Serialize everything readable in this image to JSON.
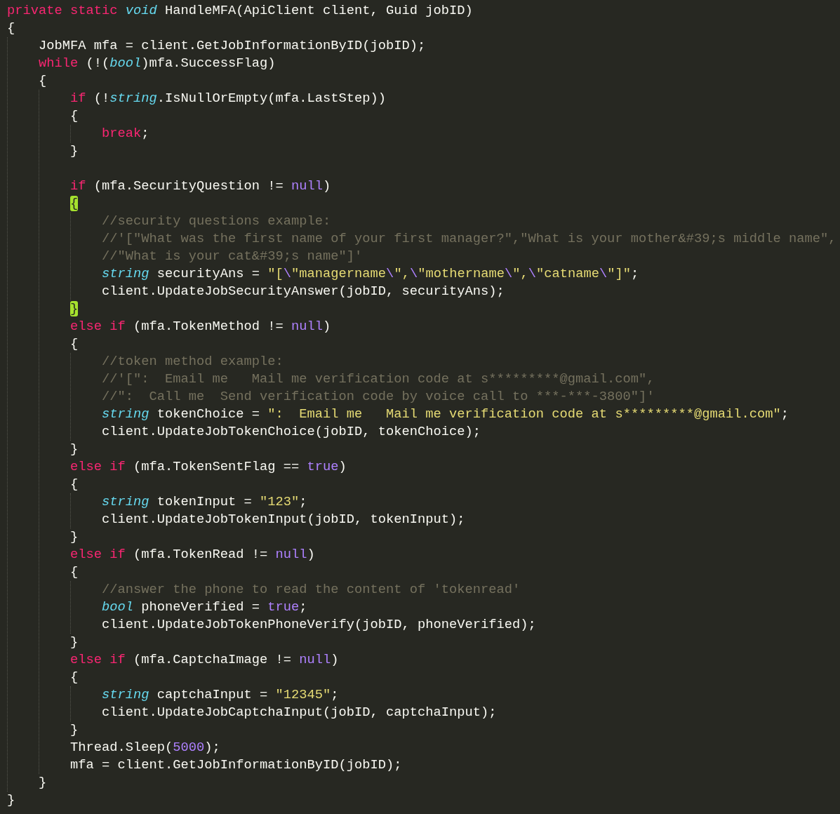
{
  "editor": {
    "lines": [
      {
        "kind": "code",
        "tokens": [
          {
            "kind": "keyword",
            "text": "private static "
          },
          {
            "kind": "type",
            "text": "void"
          },
          {
            "kind": "plain",
            "text": " HandleMFA(ApiClient client, Guid jobID)"
          }
        ]
      },
      {
        "kind": "code",
        "tokens": [
          {
            "kind": "plain",
            "text": "{"
          }
        ],
        "children": [
          {
            "kind": "code",
            "tokens": [
              {
                "kind": "plain",
                "text": "JobMFA mfa = client.GetJobInformationByID(jobID);"
              }
            ]
          },
          {
            "kind": "code",
            "tokens": [
              {
                "kind": "keyword",
                "text": "while"
              },
              {
                "kind": "plain",
                "text": " (!("
              },
              {
                "kind": "type",
                "text": "bool"
              },
              {
                "kind": "plain",
                "text": ")mfa.SuccessFlag)"
              }
            ]
          },
          {
            "kind": "code",
            "tokens": [
              {
                "kind": "plain",
                "text": "{"
              }
            ],
            "children": [
              {
                "kind": "code",
                "tokens": [
                  {
                    "kind": "keyword",
                    "text": "if"
                  },
                  {
                    "kind": "plain",
                    "text": " (!"
                  },
                  {
                    "kind": "type",
                    "text": "string"
                  },
                  {
                    "kind": "plain",
                    "text": ".IsNullOrEmpty(mfa.LastStep))"
                  }
                ]
              },
              {
                "kind": "code",
                "tokens": [
                  {
                    "kind": "plain",
                    "text": "{"
                  }
                ],
                "children": [
                  {
                    "kind": "code",
                    "tokens": [
                      {
                        "kind": "keyword",
                        "text": "break"
                      },
                      {
                        "kind": "plain",
                        "text": ";"
                      }
                    ]
                  }
                ]
              },
              {
                "kind": "code",
                "tokens": [
                  {
                    "kind": "plain",
                    "text": "}"
                  }
                ]
              },
              {
                "kind": "blank"
              },
              {
                "kind": "code",
                "tokens": [
                  {
                    "kind": "keyword",
                    "text": "if"
                  },
                  {
                    "kind": "plain",
                    "text": " (mfa.SecurityQuestion != "
                  },
                  {
                    "kind": "constant",
                    "text": "null"
                  },
                  {
                    "kind": "plain",
                    "text": ")"
                  }
                ]
              },
              {
                "kind": "code",
                "tokens": [
                  {
                    "kind": "match",
                    "text": "{"
                  }
                ],
                "children": [
                  {
                    "kind": "code",
                    "tokens": [
                      {
                        "kind": "comment",
                        "text": "//security questions example:"
                      }
                    ]
                  },
                  {
                    "kind": "code",
                    "tokens": [
                      {
                        "kind": "comment",
                        "text": "//'[\"What was the first name of your first manager?\",\"What is your mother&#39;s middle name\","
                      }
                    ]
                  },
                  {
                    "kind": "code",
                    "tokens": [
                      {
                        "kind": "comment",
                        "text": "//\"What is your cat&#39;s name\"]'"
                      }
                    ]
                  },
                  {
                    "kind": "code",
                    "tokens": [
                      {
                        "kind": "type",
                        "text": "string"
                      },
                      {
                        "kind": "plain",
                        "text": " securityAns = "
                      },
                      {
                        "kind": "string",
                        "text": "\"["
                      },
                      {
                        "kind": "escape",
                        "text": "\\"
                      },
                      {
                        "kind": "string",
                        "text": "\"managername"
                      },
                      {
                        "kind": "escape",
                        "text": "\\"
                      },
                      {
                        "kind": "string",
                        "text": "\","
                      },
                      {
                        "kind": "escape",
                        "text": "\\"
                      },
                      {
                        "kind": "string",
                        "text": "\"mothername"
                      },
                      {
                        "kind": "escape",
                        "text": "\\"
                      },
                      {
                        "kind": "string",
                        "text": "\","
                      },
                      {
                        "kind": "escape",
                        "text": "\\"
                      },
                      {
                        "kind": "string",
                        "text": "\"catname"
                      },
                      {
                        "kind": "escape",
                        "text": "\\"
                      },
                      {
                        "kind": "string",
                        "text": "\"]\""
                      },
                      {
                        "kind": "plain",
                        "text": ";"
                      }
                    ]
                  },
                  {
                    "kind": "code",
                    "tokens": [
                      {
                        "kind": "plain",
                        "text": "client.UpdateJobSecurityAnswer(jobID, securityAns);"
                      }
                    ]
                  }
                ]
              },
              {
                "kind": "code",
                "tokens": [
                  {
                    "kind": "match",
                    "text": "}"
                  }
                ]
              },
              {
                "kind": "code",
                "tokens": [
                  {
                    "kind": "keyword",
                    "text": "else if"
                  },
                  {
                    "kind": "plain",
                    "text": " (mfa.TokenMethod != "
                  },
                  {
                    "kind": "constant",
                    "text": "null"
                  },
                  {
                    "kind": "plain",
                    "text": ")"
                  }
                ]
              },
              {
                "kind": "code",
                "tokens": [
                  {
                    "kind": "plain",
                    "text": "{"
                  }
                ],
                "children": [
                  {
                    "kind": "code",
                    "tokens": [
                      {
                        "kind": "comment",
                        "text": "//token method example:"
                      }
                    ]
                  },
                  {
                    "kind": "code",
                    "tokens": [
                      {
                        "kind": "comment",
                        "text": "//'[\":  Email me   Mail me verification code at s*********@gmail.com\","
                      }
                    ]
                  },
                  {
                    "kind": "code",
                    "tokens": [
                      {
                        "kind": "comment",
                        "text": "//\":  Call me  Send verification code by voice call to ***-***-3800\"]'"
                      }
                    ]
                  },
                  {
                    "kind": "code",
                    "tokens": [
                      {
                        "kind": "type",
                        "text": "string"
                      },
                      {
                        "kind": "plain",
                        "text": " tokenChoice = "
                      },
                      {
                        "kind": "string",
                        "text": "\":  Email me   Mail me verification code at s*********@gmail.com\""
                      },
                      {
                        "kind": "plain",
                        "text": ";"
                      }
                    ]
                  },
                  {
                    "kind": "code",
                    "tokens": [
                      {
                        "kind": "plain",
                        "text": "client.UpdateJobTokenChoice(jobID, tokenChoice);"
                      }
                    ]
                  }
                ]
              },
              {
                "kind": "code",
                "tokens": [
                  {
                    "kind": "plain",
                    "text": "}"
                  }
                ]
              },
              {
                "kind": "code",
                "tokens": [
                  {
                    "kind": "keyword",
                    "text": "else if"
                  },
                  {
                    "kind": "plain",
                    "text": " (mfa.TokenSentFlag == "
                  },
                  {
                    "kind": "constant",
                    "text": "true"
                  },
                  {
                    "kind": "plain",
                    "text": ")"
                  }
                ]
              },
              {
                "kind": "code",
                "tokens": [
                  {
                    "kind": "plain",
                    "text": "{"
                  }
                ],
                "children": [
                  {
                    "kind": "code",
                    "tokens": [
                      {
                        "kind": "type",
                        "text": "string"
                      },
                      {
                        "kind": "plain",
                        "text": " tokenInput = "
                      },
                      {
                        "kind": "string",
                        "text": "\"123\""
                      },
                      {
                        "kind": "plain",
                        "text": ";"
                      }
                    ]
                  },
                  {
                    "kind": "code",
                    "tokens": [
                      {
                        "kind": "plain",
                        "text": "client.UpdateJobTokenInput(jobID, tokenInput);"
                      }
                    ]
                  }
                ]
              },
              {
                "kind": "code",
                "tokens": [
                  {
                    "kind": "plain",
                    "text": "}"
                  }
                ]
              },
              {
                "kind": "code",
                "tokens": [
                  {
                    "kind": "keyword",
                    "text": "else if"
                  },
                  {
                    "kind": "plain",
                    "text": " (mfa.TokenRead != "
                  },
                  {
                    "kind": "constant",
                    "text": "null"
                  },
                  {
                    "kind": "plain",
                    "text": ")"
                  }
                ]
              },
              {
                "kind": "code",
                "tokens": [
                  {
                    "kind": "plain",
                    "text": "{"
                  }
                ],
                "children": [
                  {
                    "kind": "code",
                    "tokens": [
                      {
                        "kind": "comment",
                        "text": "//answer the phone to read the content of 'tokenread'"
                      }
                    ]
                  },
                  {
                    "kind": "code",
                    "tokens": [
                      {
                        "kind": "type",
                        "text": "bool"
                      },
                      {
                        "kind": "plain",
                        "text": " phoneVerified = "
                      },
                      {
                        "kind": "constant",
                        "text": "true"
                      },
                      {
                        "kind": "plain",
                        "text": ";"
                      }
                    ]
                  },
                  {
                    "kind": "code",
                    "tokens": [
                      {
                        "kind": "plain",
                        "text": "client.UpdateJobTokenPhoneVerify(jobID, phoneVerified);"
                      }
                    ]
                  }
                ]
              },
              {
                "kind": "code",
                "tokens": [
                  {
                    "kind": "plain",
                    "text": "}"
                  }
                ]
              },
              {
                "kind": "code",
                "tokens": [
                  {
                    "kind": "keyword",
                    "text": "else if"
                  },
                  {
                    "kind": "plain",
                    "text": " (mfa.CaptchaImage != "
                  },
                  {
                    "kind": "constant",
                    "text": "null"
                  },
                  {
                    "kind": "plain",
                    "text": ")"
                  }
                ]
              },
              {
                "kind": "code",
                "tokens": [
                  {
                    "kind": "plain",
                    "text": "{"
                  }
                ],
                "children": [
                  {
                    "kind": "code",
                    "tokens": [
                      {
                        "kind": "type",
                        "text": "string"
                      },
                      {
                        "kind": "plain",
                        "text": " captchaInput = "
                      },
                      {
                        "kind": "string",
                        "text": "\"12345\""
                      },
                      {
                        "kind": "plain",
                        "text": ";"
                      }
                    ]
                  },
                  {
                    "kind": "code",
                    "tokens": [
                      {
                        "kind": "plain",
                        "text": "client.UpdateJobCaptchaInput(jobID, captchaInput);"
                      }
                    ]
                  }
                ]
              },
              {
                "kind": "code",
                "tokens": [
                  {
                    "kind": "plain",
                    "text": "}"
                  }
                ]
              },
              {
                "kind": "code",
                "tokens": [
                  {
                    "kind": "plain",
                    "text": "Thread.Sleep("
                  },
                  {
                    "kind": "constant",
                    "text": "5000"
                  },
                  {
                    "kind": "plain",
                    "text": ");"
                  }
                ]
              },
              {
                "kind": "code",
                "tokens": [
                  {
                    "kind": "plain",
                    "text": "mfa = client.GetJobInformationByID(jobID);"
                  }
                ]
              }
            ]
          },
          {
            "kind": "code",
            "tokens": [
              {
                "kind": "plain",
                "text": "}"
              }
            ]
          }
        ]
      },
      {
        "kind": "code",
        "tokens": [
          {
            "kind": "plain",
            "text": "}"
          }
        ]
      }
    ]
  }
}
